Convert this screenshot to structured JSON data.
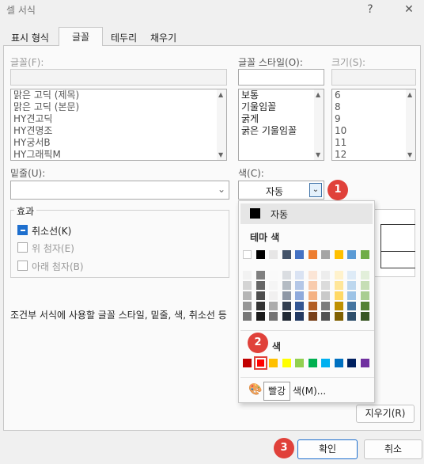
{
  "dialog": {
    "title": "셀 서식",
    "help": "?",
    "close": "✕"
  },
  "tabs": [
    {
      "label": "표시 형식"
    },
    {
      "label": "글꼴"
    },
    {
      "label": "테두리"
    },
    {
      "label": "채우기"
    }
  ],
  "font": {
    "label": "글꼴(F):",
    "items": [
      "맑은 고딕 (제목)",
      "맑은 고딕 (본문)",
      "HY견고딕",
      "HY견명조",
      "HY궁서B",
      "HY그래픽M"
    ]
  },
  "style": {
    "label": "글꼴 스타일(O):",
    "items": [
      "보통",
      "기울임꼴",
      "굵게",
      "굵은 기울임꼴"
    ]
  },
  "size": {
    "label": "크기(S):",
    "items": [
      "6",
      "8",
      "9",
      "10",
      "11",
      "12"
    ]
  },
  "underline": {
    "label": "밑줄(U):"
  },
  "color": {
    "label": "색(C):",
    "value": "자동"
  },
  "effects": {
    "title": "효과",
    "strikethrough": "취소선(K)",
    "superscript": "위 첨자(E)",
    "subscript": "아래 첨자(B)"
  },
  "footer_note": "조건부 서식에 사용할 글꼴 스타일, 밑줄, 색, 취소선 등",
  "clear_button": "지우기(R)",
  "ok_button": "확인",
  "cancel_button": "취소",
  "color_popup": {
    "auto_label": "자동",
    "theme_title": "테마 색",
    "standard_title": "색",
    "more_colors": "색(M)...",
    "tooltip": "빨강",
    "theme_colors": [
      "#ffffff",
      "#000000",
      "#e7e6e6",
      "#44546a",
      "#4472c4",
      "#ed7d31",
      "#a5a5a5",
      "#ffc000",
      "#5b9bd5",
      "#70ad47"
    ],
    "standard_colors": [
      "#c00000",
      "#ff0000",
      "#ffc000",
      "#ffff00",
      "#92d050",
      "#00b050",
      "#00b0f0",
      "#0070c0",
      "#002060",
      "#7030a0"
    ]
  },
  "badges": [
    "1",
    "2",
    "3"
  ]
}
